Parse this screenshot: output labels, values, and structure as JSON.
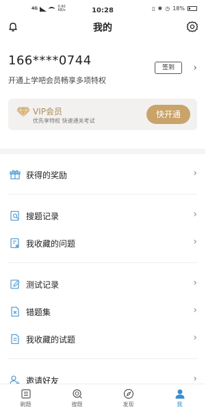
{
  "status_bar": {
    "network": "4G",
    "speed": "0.90 KB/s",
    "time": "10:28",
    "battery": "18%"
  },
  "nav": {
    "title": "我的"
  },
  "profile": {
    "phone": "166****0744",
    "subtitle": "开通上学吧会员畅享多项特权",
    "checkin_label": "签到"
  },
  "vip": {
    "title": "VIP会员",
    "subtitle": "优先享特权 快速通关考试",
    "button_label": "快开通",
    "accent_color": "#c9a369"
  },
  "menu": {
    "items": [
      {
        "label": "获得的奖励",
        "icon": "gift-icon"
      },
      {
        "label": "搜题记录",
        "icon": "search-doc-icon"
      },
      {
        "label": "我收藏的问题",
        "icon": "favorite-doc-icon"
      },
      {
        "label": "测试记录",
        "icon": "edit-icon"
      },
      {
        "label": "错题集",
        "icon": "wrong-doc-icon"
      },
      {
        "label": "我收藏的试题",
        "icon": "favorite-paper-icon"
      },
      {
        "label": "邀请好友",
        "icon": "invite-icon"
      }
    ]
  },
  "tabs": [
    {
      "label": "刷题",
      "icon": "list-icon"
    },
    {
      "label": "搜题",
      "icon": "search-icon"
    },
    {
      "label": "发现",
      "icon": "compass-icon"
    },
    {
      "label": "我",
      "icon": "person-icon",
      "active": true
    }
  ]
}
